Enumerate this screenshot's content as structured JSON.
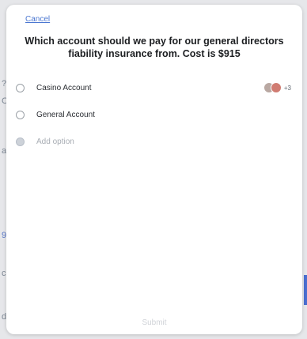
{
  "dialog": {
    "cancel_label": "Cancel",
    "question": "Which account should we pay for our general directors fiability insurance from. Cost is $915",
    "submit_label": "Submit"
  },
  "options": [
    {
      "label": "Casino Account",
      "voters_more": "+3"
    },
    {
      "label": "General Account"
    }
  ],
  "add_option_placeholder": "Add option",
  "background": {
    "fragments": [
      "?",
      "C",
      "a",
      "9",
      "c",
      "d"
    ]
  }
}
